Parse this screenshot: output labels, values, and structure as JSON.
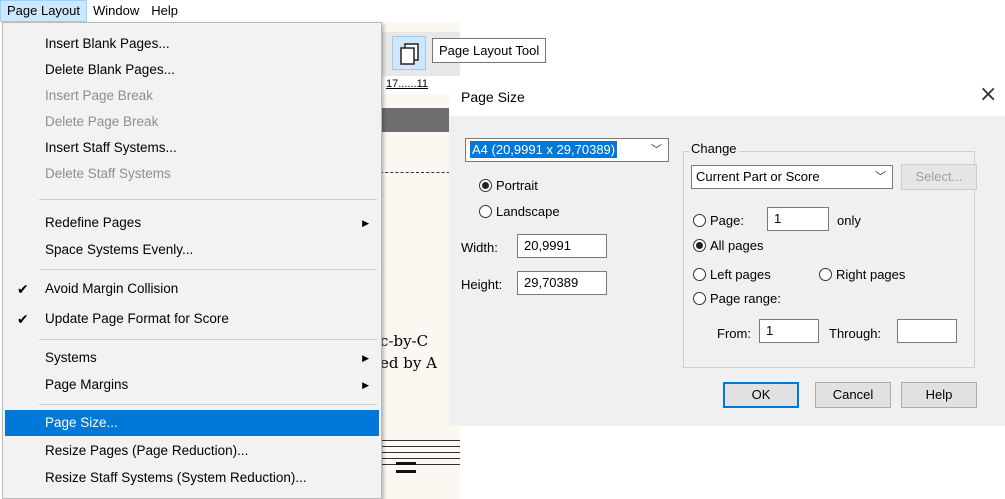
{
  "menubar": {
    "items": [
      {
        "label": "Page Layout",
        "active": true
      },
      {
        "label": "Window",
        "active": false
      },
      {
        "label": "Help",
        "active": false
      }
    ]
  },
  "menu": {
    "items": [
      {
        "label": "Insert Blank Pages...",
        "enabled": true
      },
      {
        "label": "Delete Blank Pages...",
        "enabled": true
      },
      {
        "label": "Insert Page Break",
        "enabled": false
      },
      {
        "label": "Delete Page Break",
        "enabled": false
      },
      {
        "label": "Insert Staff Systems...",
        "enabled": true
      },
      {
        "label": "Delete Staff Systems",
        "enabled": false
      },
      {
        "label": "Redefine Pages",
        "enabled": true,
        "submenu": true
      },
      {
        "label": "Space Systems Evenly...",
        "enabled": true
      },
      {
        "label": "Avoid Margin Collision",
        "enabled": true,
        "checked": true
      },
      {
        "label": "Update Page Format for Score",
        "enabled": true,
        "checked": true
      },
      {
        "label": "Systems",
        "enabled": true,
        "submenu": true
      },
      {
        "label": "Page Margins",
        "enabled": true,
        "submenu": true
      },
      {
        "label": "Page Size...",
        "enabled": true,
        "selected": true
      },
      {
        "label": "Resize Pages (Page Reduction)...",
        "enabled": true
      },
      {
        "label": "Resize Staff Systems (System Reduction)...",
        "enabled": true
      }
    ],
    "check_glyph": "✔",
    "submenu_glyph": "▶"
  },
  "tooltip": {
    "text": "Page Layout Tool"
  },
  "document": {
    "ruler_text": "17......11",
    "score_line1": "c-by-C",
    "score_line2": "ed by A"
  },
  "dialog": {
    "title": "Page Size",
    "close_glyph": "×",
    "size_select": {
      "value": "A4 (20,9991 x 29,70389)"
    },
    "orientation": {
      "portrait_label": "Portrait",
      "landscape_label": "Landscape",
      "selected": "portrait"
    },
    "width_label": "Width:",
    "width_value": "20,9991",
    "height_label": "Height:",
    "height_value": "29,70389",
    "change": {
      "group_label": "Change",
      "scope_select": {
        "value": "Current Part or Score"
      },
      "select_button": "Select...",
      "page_label": "Page:",
      "page_value": "1",
      "only_label": "only",
      "all_pages_label": "All pages",
      "left_pages_label": "Left pages",
      "right_pages_label": "Right pages",
      "page_range_label": "Page range:",
      "from_label": "From:",
      "from_value": "1",
      "through_label": "Through:",
      "through_value": "",
      "selected": "all_pages"
    },
    "buttons": {
      "ok": "OK",
      "cancel": "Cancel",
      "help": "Help"
    }
  },
  "colors": {
    "accent": "#0078d7",
    "menu_bg": "#f2f2f2",
    "dialog_bg": "#f0f0f0",
    "disabled_text": "#8e8e8e"
  }
}
